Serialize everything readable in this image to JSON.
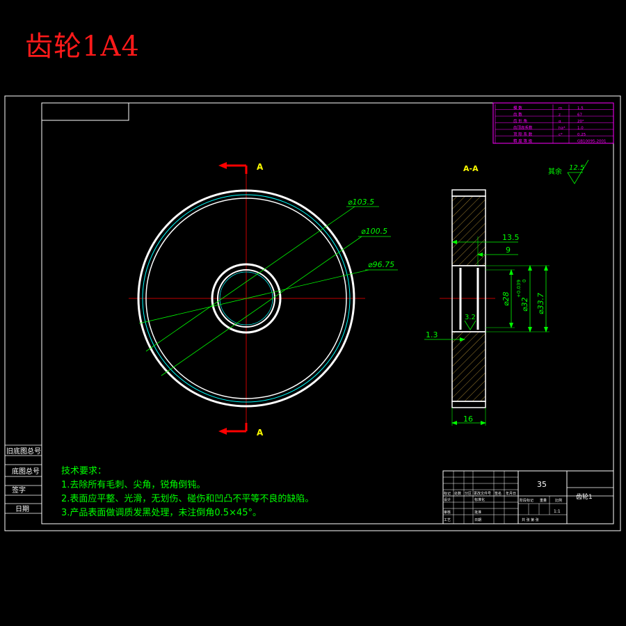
{
  "title": "齿轮1A4",
  "colors": {
    "background": "#000000",
    "frame": "#ffffff",
    "dimension": "#00ff00",
    "centerline": "#ff0000",
    "section_label": "#ffff00",
    "table": "#ff00ff",
    "hatch": "#c8a040",
    "title_red": "#ff1a1a",
    "outline_cyan": "#00ffff"
  },
  "front_view": {
    "section_marker": "A",
    "diameter_labels": [
      "⌀103.5",
      "⌀100.5",
      "⌀96.75"
    ]
  },
  "side_view": {
    "section_label": "A-A",
    "dims": {
      "width_135": "13.5",
      "width_9": "9",
      "dia_28": "⌀28",
      "dia_32": "⌀32",
      "dia_32_tol_upper": "+0.039",
      "dia_32_tol_lower": "0",
      "dia_337": "⌀33.7",
      "chamfer_13": "1.3",
      "width_16": "16",
      "roughness_32": "3.2"
    }
  },
  "rest_roughness": {
    "label": "其余",
    "value": "12.5"
  },
  "gear_params": [
    {
      "name": "模 数",
      "symbol": "m",
      "value": "1.5"
    },
    {
      "name": "齿 数",
      "symbol": "z",
      "value": "67"
    },
    {
      "name": "齿 形 角",
      "symbol": "α",
      "value": "20°"
    },
    {
      "name": "齿顶高系数",
      "symbol": "ha*",
      "value": "1.0"
    },
    {
      "name": "顶 隙 系 数",
      "symbol": "c*",
      "value": "0.25"
    },
    {
      "name": "精 度 等 级",
      "symbol": "",
      "value": "GB10095-2001"
    }
  ],
  "tech_requirements": {
    "heading": "技术要求：",
    "items": [
      "1.去除所有毛刺、尖角，锐角倒钝。",
      "2.表面应平整、光滑，无划伤、碰伤和凹凸不平等不良的缺陷。",
      "3.产品表面做调质发黑处理，未注倒角0.5×45°。"
    ]
  },
  "side_labels": [
    "旧底图总号",
    "底图总号",
    "签字",
    "日期"
  ],
  "title_block": {
    "material": "35",
    "part_name": "齿轮1",
    "scale": "1:1",
    "row_labels_top": [
      "标记",
      "处数",
      "分区",
      "更改文件号",
      "签名",
      "年月日"
    ],
    "row_labels_left": [
      "设计",
      "审核",
      "工艺"
    ],
    "row_labels_mid": [
      "标准化",
      "批准",
      "日期"
    ],
    "stage_labels": [
      "阶段标记",
      "重量",
      "比例"
    ],
    "sheet_label": "共 张 第 张"
  }
}
